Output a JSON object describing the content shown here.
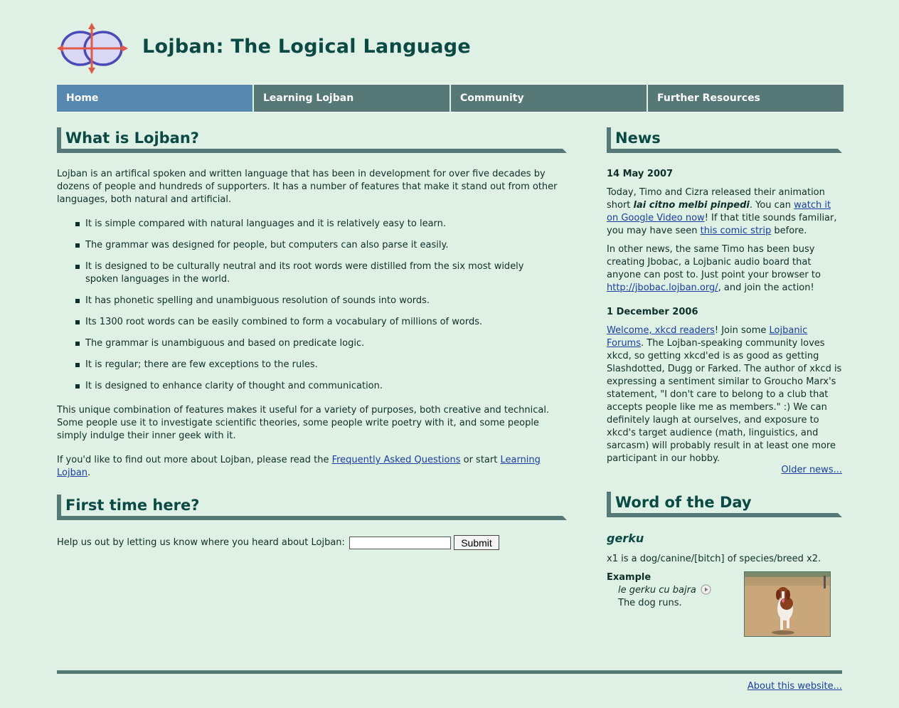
{
  "site": {
    "title": "Lojban: The Logical Language"
  },
  "nav": {
    "items": [
      {
        "label": "Home",
        "active": true
      },
      {
        "label": "Learning Lojban",
        "active": false
      },
      {
        "label": "Community",
        "active": false
      },
      {
        "label": "Further Resources",
        "active": false
      }
    ]
  },
  "what": {
    "heading": "What is Lojban?",
    "intro": "Lojban is an artifical spoken and written language that has been in development for over five decades by dozens of people and hundreds of supporters. It has a number of features that make it stand out from other languages, both natural and artificial.",
    "features": [
      "It is simple compared with natural languages and it is relatively easy to learn.",
      "The grammar was designed for people, but computers can also parse it easily.",
      "It is designed to be culturally neutral and its root words were distilled from the six most widely spoken languages in the world.",
      "It has phonetic spelling and unambiguous resolution of sounds into words.",
      "Its 1300 root words can be easily combined to form a vocabulary of millions of words.",
      "The grammar is unambiguous and based on predicate logic.",
      "It is regular; there are few exceptions to the rules.",
      "It is designed to enhance clarity of thought and communication."
    ],
    "combo": "This unique combination of features makes it useful for a variety of purposes, both creative and technical. Some people use it to investigate scientific theories, some people write poetry with it, and some people simply indulge their inner geek with it.",
    "more_prefix": "If you'd like to find out more about Lojban, please read the ",
    "faq_link": "Frequently Asked Questions",
    "more_mid": " or start ",
    "learning_link": "Learning Lojban",
    "more_suffix": "."
  },
  "first": {
    "heading": "First time here?",
    "prompt": "Help us out by letting us know where you heard about Lojban:",
    "input_value": "",
    "submit_label": "Submit"
  },
  "news": {
    "heading": "News",
    "items": [
      {
        "date": "14 May 2007",
        "p1_a": "Today, Timo and Cizra released their animation short ",
        "p1_title": "lai citno melbi pinpedi",
        "p1_b": ". You can ",
        "p1_link1": "watch it on Google Video now",
        "p1_c": "! If that title sounds familiar, you may have seen ",
        "p1_link2": "this comic strip",
        "p1_d": " before.",
        "p2_a": "In other news, the same Timo has been busy creating Jbobac, a Lojbanic audio board that anyone can post to. Just point your browser to ",
        "p2_link": "http://jbobac.lojban.org/",
        "p2_b": ", and join the action!"
      },
      {
        "date": "1 December 2006",
        "link1": "Welcome, xkcd readers",
        "a": "! Join some ",
        "link2": "Lojbanic Forums",
        "b": ". The Lojban-speaking community loves xkcd, so getting xkcd'ed is as good as getting Slashdotted, Dugg or Farked. The author of xkcd is expressing a sentiment similar to Groucho Marx's statement, \"I don't care to belong to a club that accepts people like me as members.\" :) We can definitely laugh at ourselves, and exposure to xkcd's target audience (math, linguistics, and sarcasm) will probably result in at least one more participant in our hobby."
      }
    ],
    "older_link": "Older news..."
  },
  "wotd": {
    "heading": "Word of the Day",
    "word": "gerku",
    "definition": "x1 is a dog/canine/[bitch] of species/breed x2.",
    "example_label": "Example",
    "example_lojban": "le gerku cu bajra",
    "example_english": "The dog runs.",
    "play_icon": "play-audio-icon",
    "image_alt": "dog running on sand"
  },
  "footer": {
    "about_link": "About this website..."
  },
  "colors": {
    "background": "#dff0e5",
    "nav": "#567876",
    "nav_active": "#5788b0",
    "heading": "#0b4a44",
    "link": "#1a3fa0"
  }
}
